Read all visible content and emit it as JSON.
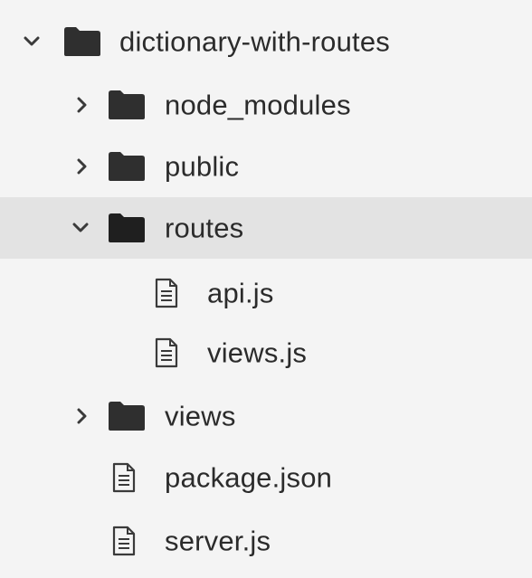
{
  "tree": {
    "root": {
      "label": "dictionary-with-routes",
      "icon": "folder-icon",
      "expanded": true
    },
    "items": [
      {
        "label": "node_modules",
        "icon": "folder-icon",
        "expanded": false
      },
      {
        "label": "public",
        "icon": "folder-icon",
        "expanded": false
      },
      {
        "label": "routes",
        "icon": "folder-icon",
        "expanded": true,
        "selected": true
      },
      {
        "label": "api.js",
        "icon": "file-icon"
      },
      {
        "label": "views.js",
        "icon": "file-icon"
      },
      {
        "label": "views",
        "icon": "folder-icon",
        "expanded": false
      },
      {
        "label": "package.json",
        "icon": "file-icon"
      },
      {
        "label": "server.js",
        "icon": "file-icon"
      }
    ]
  },
  "colors": {
    "background": "#f4f4f4",
    "selected_row": "#e3e3e3",
    "folder": "#2f2f2f",
    "text": "#2b2b2b",
    "chevron": "#3a3a3a"
  }
}
